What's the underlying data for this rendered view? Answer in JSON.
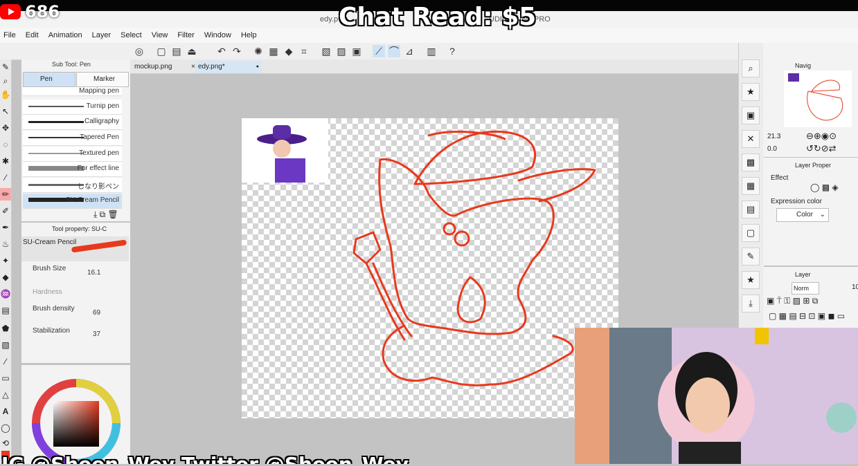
{
  "stream": {
    "youtube_count": "686",
    "chat_read": "Chat Read: $5",
    "ticker": "IG @Sheen_Wey Twitter @Sheen_Wey"
  },
  "window": {
    "title_left": "edy.p",
    "title_right": "UDIO PAINT PRO"
  },
  "menu": [
    "File",
    "Edit",
    "Animation",
    "Layer",
    "Select",
    "View",
    "Filter",
    "Window",
    "Help"
  ],
  "subtool": {
    "header": "Sub Tool: Pen",
    "tabs": [
      "Pen",
      "Marker"
    ],
    "brushes": [
      "Mapping pen",
      "Turnip pen",
      "Calligraphy",
      "Tapered Pen",
      "Textured pen",
      "For effect line",
      "しなり影ペン",
      "SU-Cream Pencil"
    ]
  },
  "toolprop": {
    "header": "Tool property: SU-C",
    "brush_name": "SU-Cream Pencil",
    "brush_size_label": "Brush Size",
    "brush_size": "16.1",
    "hardness_label": "Hardness",
    "density_label": "Brush density",
    "density": "69",
    "stabilization_label": "Stabilization",
    "stabilization": "37"
  },
  "docs": {
    "tab1": "mockup.png",
    "tab2": "edy.png*",
    "close": "×",
    "dot": "●"
  },
  "navigator": {
    "header": "Navig",
    "zoom": "21.3",
    "angle": "0.0"
  },
  "layerprop": {
    "header": "Layer Proper",
    "effect_label": "Effect",
    "expression_label": "Expression color",
    "expression_value": "Color"
  },
  "layer": {
    "header": "Layer",
    "blend": "Norm",
    "opacity": "10"
  },
  "colors": {
    "sketch": "#e8391d",
    "accent": "#cfe2f5",
    "youtube": "#ff0000"
  }
}
